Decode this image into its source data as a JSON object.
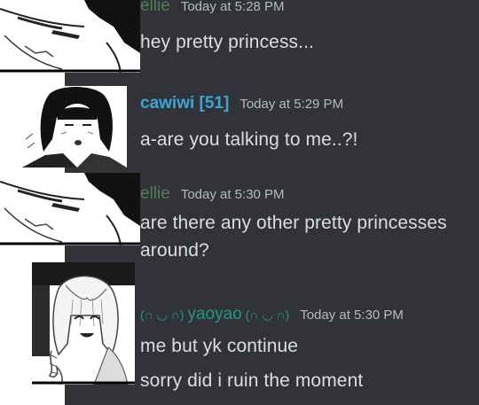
{
  "colors": {
    "chat_background": "#313338",
    "message_text": "#dbdee1",
    "timestamp": "#b5bac1",
    "ellie_name": "#4f7f55",
    "cawiwi_name": "#3ba7d8",
    "yaoyao_name": "#1f9a86"
  },
  "messages": [
    {
      "username": "ellie",
      "timestamp": "Today at 5:28 PM",
      "lines": [
        "hey pretty princess..."
      ],
      "avatar": "ellie-manga-avatar"
    },
    {
      "username": "cawiwi [51]",
      "timestamp": "Today at 5:29 PM",
      "lines": [
        "a-are you talking to me..?!"
      ],
      "avatar": "cawiwi-manga-avatar"
    },
    {
      "username": "ellie",
      "timestamp": "Today at 5:30 PM",
      "lines": [
        "are there any other pretty princesses",
        "around?"
      ],
      "avatar": "ellie-manga-avatar"
    },
    {
      "username_prefix": "(∩ ◡ ∩)",
      "username": "yaoyao",
      "username_suffix": "(∩ ◡ ∩)",
      "timestamp": "Today at 5:30 PM",
      "lines": [
        "me but yk continue",
        "sorry did i ruin the moment"
      ],
      "avatar": "yaoyao-manga-avatar"
    }
  ]
}
